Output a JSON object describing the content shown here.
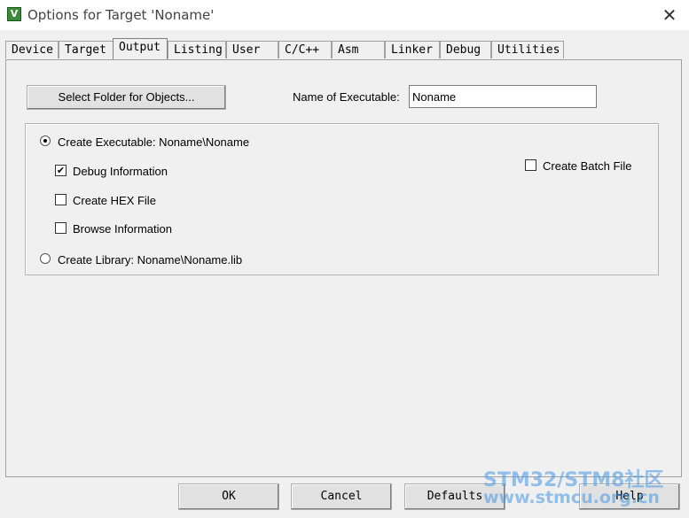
{
  "window": {
    "title": "Options for Target 'Noname'",
    "icon_glyph": "V",
    "close_glyph": "✕"
  },
  "tabs": [
    {
      "label": "Device"
    },
    {
      "label": "Target"
    },
    {
      "label": "Output"
    },
    {
      "label": "Listing"
    },
    {
      "label": "User"
    },
    {
      "label": "C/C++"
    },
    {
      "label": "Asm"
    },
    {
      "label": "Linker"
    },
    {
      "label": "Debug"
    },
    {
      "label": "Utilities"
    }
  ],
  "output": {
    "select_folder_label": "Select Folder for Objects...",
    "name_label": "Name of Executable:",
    "name_value": "Noname",
    "create_executable": {
      "label": "Create Executable:  Noname\\Noname",
      "selected": true
    },
    "debug_info": {
      "label": "Debug Information",
      "checked": true
    },
    "create_hex": {
      "label": "Create HEX File",
      "checked": false
    },
    "browse_info": {
      "label": "Browse Information",
      "checked": false
    },
    "create_library": {
      "label": "Create Library:  Noname\\Noname.lib",
      "selected": false
    },
    "create_batch": {
      "label": "Create Batch File",
      "checked": false
    }
  },
  "footer": {
    "ok": "OK",
    "cancel": "Cancel",
    "defaults": "Defaults",
    "help": "Help"
  },
  "watermark": {
    "line1": "STM32/STM8社区",
    "line2": "www.stmcu.org.cn"
  },
  "check_glyph": "✔"
}
